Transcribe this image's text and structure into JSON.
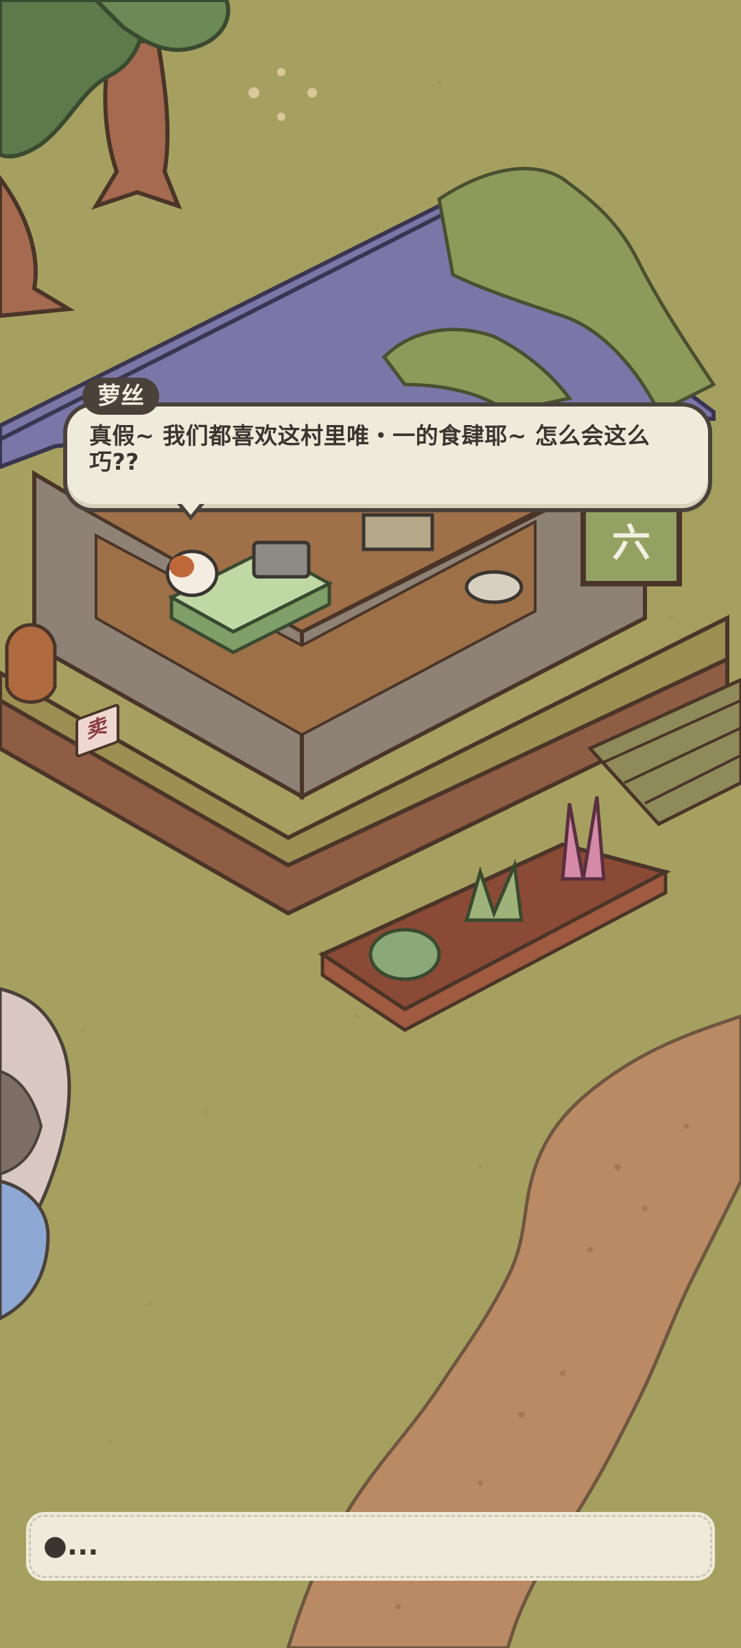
{
  "dialog": {
    "speaker": "萝丝",
    "text": "真假~ 我们都喜欢这村里唯・一的食肆耶~ 怎么会这么巧??"
  },
  "shop": {
    "sign_label": "卖"
  },
  "chat_bar": {
    "text": "●..."
  },
  "colors": {
    "grass": "#a6a060",
    "dialog_bg": "#efebdb",
    "dialog_border": "#4a423a",
    "roof": "#7b76a8",
    "path": "#b98a63",
    "water": "#8da8d4"
  }
}
